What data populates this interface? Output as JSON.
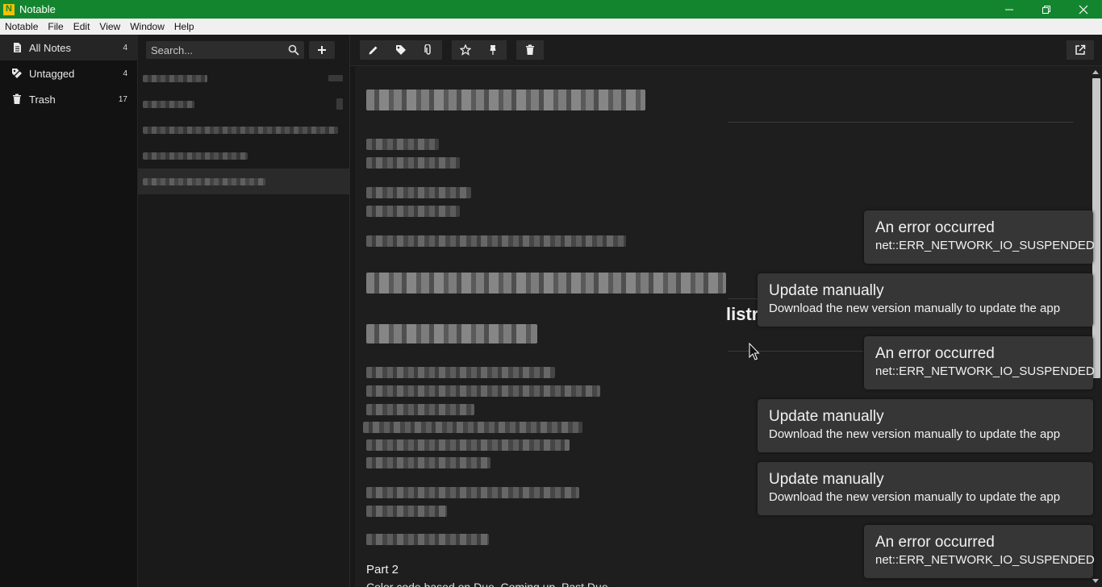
{
  "window": {
    "title": "Notable",
    "logo_letter": "N",
    "accent": "#14852f"
  },
  "menu": [
    "Notable",
    "File",
    "Edit",
    "View",
    "Window",
    "Help"
  ],
  "sidebar": {
    "items": [
      {
        "label": "All Notes",
        "count": "4",
        "icon": "notes-icon"
      },
      {
        "label": "Untagged",
        "count": "4",
        "icon": "untagged-icon"
      },
      {
        "label": "Trash",
        "count": "17",
        "icon": "trash-icon"
      }
    ]
  },
  "notelist": {
    "search_placeholder": "Search..."
  },
  "editor": {
    "visible_heading_fragment": "listr",
    "part_heading": "Part 2",
    "part_subline": "Color code based on Due, Coming up, Past Due"
  },
  "toasts": [
    {
      "title": "An error occurred",
      "body": "net::ERR_NETWORK_IO_SUSPENDED"
    },
    {
      "title": "Update manually",
      "body": "Download the new version manually to update the app"
    },
    {
      "title": "An error occurred",
      "body": "net::ERR_NETWORK_IO_SUSPENDED"
    },
    {
      "title": "Update manually",
      "body": "Download the new version manually to update the app"
    },
    {
      "title": "Update manually",
      "body": "Download the new version manually to update the app"
    },
    {
      "title": "An error occurred",
      "body": "net::ERR_NETWORK_IO_SUSPENDED"
    }
  ]
}
